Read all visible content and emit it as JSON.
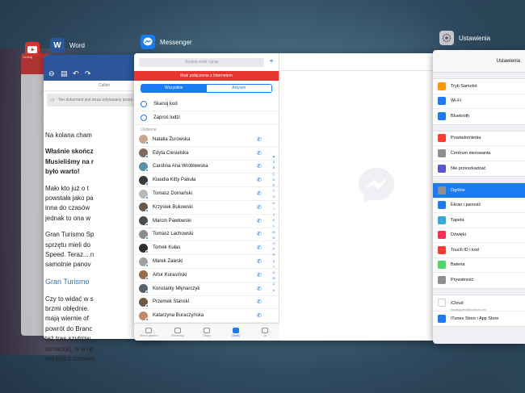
{
  "apps": {
    "youtube": {
      "color": "#e52d27"
    },
    "word": {
      "name": "Word",
      "color": "#2b579a"
    },
    "messenger": {
      "name": "Messenger",
      "color": "#1a7cf5"
    },
    "settings": {
      "name": "Ustawienia",
      "color": "#8e8e93"
    }
  },
  "youtube_card": {
    "text": "Szukaj"
  },
  "word_card": {
    "font": "Calibri",
    "banner": "Ten dokument jest teraz edytowany przez...",
    "paragraphs": [
      {
        "style": "normal",
        "lines": [
          "Na kolana cham"
        ]
      },
      {
        "style": "bold",
        "lines": [
          "Właśnie skończ",
          "Musieliśmy na r",
          "było warto!"
        ]
      },
      {
        "style": "normal",
        "lines": [
          "Mało kto już o t",
          "powstała jako pa",
          "inna do czasów",
          "jednak to ona w"
        ]
      },
      {
        "style": "normal",
        "lines": [
          "Gran Turismo Sp",
          "sprzętu mieli do",
          "Speed. Teraz... n",
          "samotnie panov"
        ]
      },
      {
        "style": "head",
        "lines": [
          "Gran Turismo"
        ]
      },
      {
        "style": "normal",
        "lines": [
          "Czy to widać w s",
          "brzmi obłędnie.",
          "mają wiernie of",
          "powrót do Branc",
          "też tras szutrow",
          "oznacza), a w ra",
          "ma być z czasem"
        ]
      }
    ]
  },
  "messenger": {
    "search_placeholder": "Szukaj osób i grup",
    "plus": "+",
    "offline_banner": "Brak połączenia z Internetem",
    "segments": [
      "Wszystkie",
      "Aktywni"
    ],
    "actions": [
      "Skanuj kod",
      "Zaproś ludzi"
    ],
    "section_label": "Ulubione",
    "contacts": [
      {
        "name": "Natalia Żurowska",
        "color": "#c9a48a"
      },
      {
        "name": "Edyta Ciesielska",
        "color": "#7d6a5c"
      },
      {
        "name": "Carolina Ana Wróblewska",
        "color": "#5b8fa8"
      },
      {
        "name": "Klaudia Kitty Pakuła",
        "color": "#3a3a3a"
      },
      {
        "name": "Tomasz Domański",
        "color": "#b8b8b8"
      },
      {
        "name": "Krzysiek Bukowski",
        "color": "#6a5a4a"
      },
      {
        "name": "Marcin Pawłowski",
        "color": "#4b4b4b"
      },
      {
        "name": "Tomasz Lachowski",
        "color": "#8c8c8c"
      },
      {
        "name": "Tomek Kułas",
        "color": "#2e2e2e"
      },
      {
        "name": "Marek Zaleski",
        "color": "#a0a0a0"
      },
      {
        "name": "Artur Kurasiński",
        "color": "#9a6a4a"
      },
      {
        "name": "Konstanty Młynarczyk",
        "color": "#55606a"
      },
      {
        "name": "Przemek Stanski",
        "color": "#6f5a48"
      },
      {
        "name": "Katarzyna Buraczyńska",
        "color": "#c28a6a"
      },
      {
        "name": "Daniel Cieślak",
        "color": "#7a7a7a"
      }
    ],
    "alphabet": [
      "▲",
      "A",
      "B",
      "C",
      "D",
      "E",
      "F",
      "G",
      "H",
      "I",
      "J",
      "K",
      "L",
      "M",
      "N",
      "O",
      "P",
      "R",
      "S",
      "T",
      "U",
      "W",
      "Z",
      "#"
    ],
    "tabs": [
      {
        "label": "Strona główna",
        "active": false
      },
      {
        "label": "Rozmowy",
        "active": false
      },
      {
        "label": "Grupy",
        "active": false
      },
      {
        "label": "Osoby",
        "active": true
      },
      {
        "label": "Ja",
        "active": false
      }
    ]
  },
  "settings": {
    "title": "Ustawienia",
    "groups": [
      [
        {
          "label": "Tryb Samolot",
          "color": "#ff9500"
        },
        {
          "label": "Wi-Fi",
          "color": "#1a7cf5"
        },
        {
          "label": "Bluetooth",
          "color": "#1a7cf5"
        }
      ],
      [
        {
          "label": "Powiadomienia",
          "color": "#ff3b30"
        },
        {
          "label": "Centrum sterowania",
          "color": "#8e8e93"
        },
        {
          "label": "Nie przeszkadzać",
          "color": "#5856d6"
        }
      ],
      [
        {
          "label": "Ogólne",
          "color": "#8e8e93",
          "active": true
        },
        {
          "label": "Ekran i jasność",
          "color": "#1a7cf5"
        },
        {
          "label": "Tapeta",
          "color": "#34aadc"
        },
        {
          "label": "Dźwięki",
          "color": "#ff2d55"
        },
        {
          "label": "Touch ID i kod",
          "color": "#ff3b30"
        },
        {
          "label": "Bateria",
          "color": "#4cd964"
        },
        {
          "label": "Prywatność",
          "color": "#8e8e93"
        }
      ],
      [
        {
          "label": "iCloud",
          "sub": "maciejgorecki@outlook.com",
          "color": "#ffffff"
        },
        {
          "label": "iTunes Store i App Store",
          "color": "#1a7cf5"
        }
      ]
    ]
  }
}
